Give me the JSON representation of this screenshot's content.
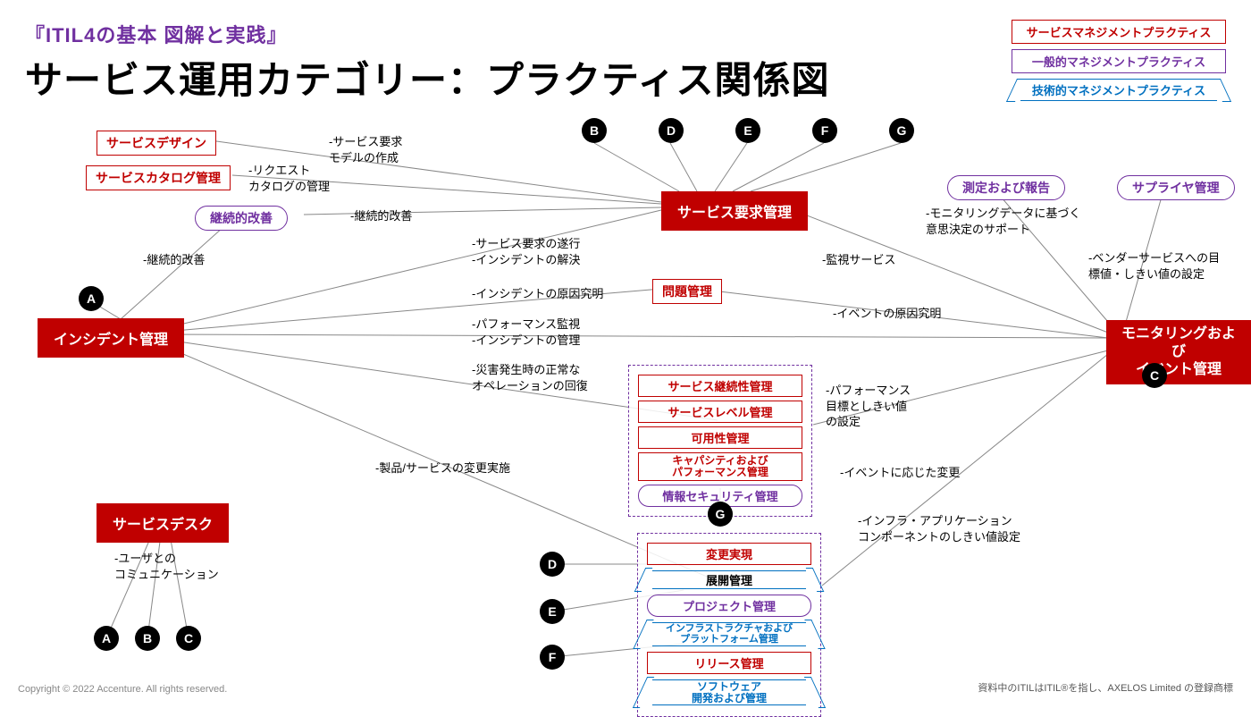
{
  "header": {
    "small": "『ITIL4の基本 図解と実践』",
    "main": "サービス運用カテゴリー：プラクティス関係図"
  },
  "legend": {
    "svc": "サービスマネジメントプラクティス",
    "gen": "一般的マネジメントプラクティス",
    "tech": "技術的マネジメントプラクティス"
  },
  "nodes": {
    "incident": "インシデント管理",
    "servicedesk": "サービスデスク",
    "svcreq": "サービス要求管理",
    "monitoring_l1": "モニタリングおよび",
    "monitoring_l2": "イベント管理",
    "svcdesign": "サービスデザイン",
    "svccatalog": "サービスカタログ管理",
    "continual": "継続的改善",
    "problem": "問題管理",
    "measure": "測定および報告",
    "supplier": "サプライヤ管理"
  },
  "groupG": {
    "svccont": "サービス継続性管理",
    "svclvl": "サービスレベル管理",
    "avail": "可用性管理",
    "cap1": "キャパシティおよび",
    "cap2": "パフォーマンス管理",
    "infosec": "情報セキュリティ管理"
  },
  "groupD": {
    "change": "変更実現",
    "deploy": "展開管理",
    "project": "プロジェクト管理",
    "infra1": "インフラストラクチャおよび",
    "infra2": "プラットフォーム管理",
    "release": "リリース管理",
    "sw1": "ソフトウェア",
    "sw2": "開発および管理"
  },
  "labels": {
    "svc_req_model": "-サービス要求\nモデルの作成",
    "req_catalog": "-リクエスト\nカタログの管理",
    "cont_improve": "-継続的改善",
    "cont_improve2": "-継続的改善",
    "svc_req_exec": "-サービス要求の遂行\n-インシデントの解決",
    "inc_cause": "-インシデントの原因究明",
    "perf_mon": "-パフォーマンス監視\n-インシデントの管理",
    "disaster": "-災害発生時の正常な\nオペレーションの回復",
    "prod_change": "-製品/サービスの変更実施",
    "mon_svc": "-監視サービス",
    "mon_decision": "-モニタリングデータに基づく\n意思決定のサポート",
    "vendor": "-ベンダーサービスへの目\n標値・しきい値の設定",
    "evt_cause": "-イベントの原因究明",
    "perf_target": "-パフォーマンス\n目標としきい値\nの設定",
    "evt_change": "-イベントに応じた変更",
    "infra_thresh": "-インフラ・アプリケーション\nコンポーネントのしきい値設定",
    "user_comm": "-ユーザとの\nコミュニケーション"
  },
  "circles": {
    "A": "A",
    "B": "B",
    "C": "C",
    "D": "D",
    "E": "E",
    "F": "F",
    "G": "G"
  },
  "footer": {
    "left": "Copyright © 2022 Accenture. All rights reserved.",
    "right": "資料中のITILはITIL®を指し、AXELOS Limited の登録商標"
  }
}
